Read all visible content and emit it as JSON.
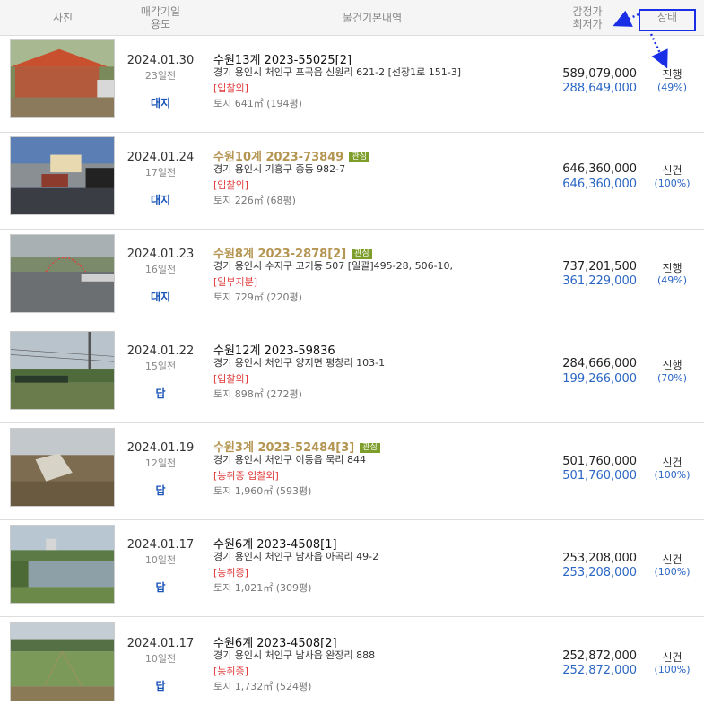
{
  "header": {
    "photo": "사진",
    "date_line1": "매각기일",
    "date_line2": "용도",
    "info": "물건기본내역",
    "price_line1": "감정가",
    "price_line2": "최저가",
    "status": "상태"
  },
  "accent_colors": {
    "annotation": "#1a2ee6",
    "link_blue": "#2b66c4",
    "gold": "#b49552",
    "red": "#e03a3a"
  },
  "rows": [
    {
      "date": "2024.01.30",
      "ago": "23일전",
      "use": "대지",
      "case": "수원13계 2023-55025[2]",
      "interest": "",
      "addr": "경기 용인시 처인구 포곡읍 신원리 621-2 [선장1로 151-3]",
      "tags": "[입찰외]",
      "land": "토지 641㎡ (194평)",
      "appraised": "589,079,000",
      "minimum": "288,649,000",
      "status": "진행",
      "pct": "(49%)"
    },
    {
      "date": "2024.01.24",
      "ago": "17일전",
      "use": "대지",
      "case": "수원10계 2023-73849",
      "interest": "관심",
      "addr": "경기 용인시 기흥구 중동 982-7",
      "tags": "[입찰외]",
      "land": "토지 226㎡ (68평)",
      "appraised": "646,360,000",
      "minimum": "646,360,000",
      "status": "신건",
      "pct": "(100%)"
    },
    {
      "date": "2024.01.23",
      "ago": "16일전",
      "use": "대지",
      "case": "수원8계 2023-2878[2]",
      "interest": "관심",
      "addr": "경기 용인시 수지구 고기동 507 [일괄]495-28, 506-10,",
      "tags": "[일부지분]",
      "land": "토지 729㎡ (220평)",
      "appraised": "737,201,500",
      "minimum": "361,229,000",
      "status": "진행",
      "pct": "(49%)"
    },
    {
      "date": "2024.01.22",
      "ago": "15일전",
      "use": "답",
      "case": "수원12계 2023-59836",
      "interest": "",
      "addr": "경기 용인시 처인구 양지면 평창리 103-1",
      "tags": "[입찰외]",
      "land": "토지 898㎡ (272평)",
      "appraised": "284,666,000",
      "minimum": "199,266,000",
      "status": "진행",
      "pct": "(70%)"
    },
    {
      "date": "2024.01.19",
      "ago": "12일전",
      "use": "답",
      "case": "수원3계 2023-52484[3]",
      "interest": "관심",
      "addr": "경기 용인시 처인구 이동읍 묵리 844",
      "tags": "[농취증   입찰외]",
      "land": "토지 1,960㎡ (593평)",
      "appraised": "501,760,000",
      "minimum": "501,760,000",
      "status": "신건",
      "pct": "(100%)"
    },
    {
      "date": "2024.01.17",
      "ago": "10일전",
      "use": "답",
      "case": "수원6계 2023-4508[1]",
      "interest": "",
      "addr": "경기 용인시 처인구 남사읍 아곡리 49-2",
      "tags": "[농취증]",
      "land": "토지 1,021㎡ (309평)",
      "appraised": "253,208,000",
      "minimum": "253,208,000",
      "status": "신건",
      "pct": "(100%)"
    },
    {
      "date": "2024.01.17",
      "ago": "10일전",
      "use": "답",
      "case": "수원6계 2023-4508[2]",
      "interest": "",
      "addr": "경기 용인시 처인구 남사읍 완장리 888",
      "tags": "[농취증]",
      "land": "토지 1,732㎡ (524평)",
      "appraised": "252,872,000",
      "minimum": "252,872,000",
      "status": "신건",
      "pct": "(100%)"
    }
  ]
}
